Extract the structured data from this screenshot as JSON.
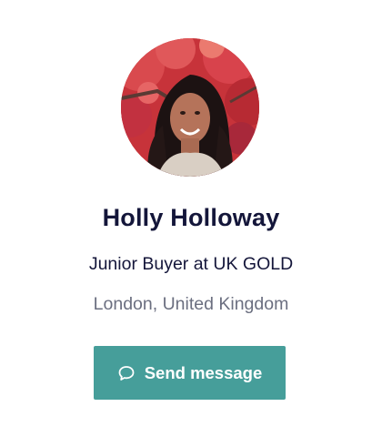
{
  "profile": {
    "name": "Holly Holloway",
    "role": "Junior Buyer at UK GOLD",
    "location": "London, United Kingdom",
    "avatar_icon": "profile-photo"
  },
  "actions": {
    "send_message_label": "Send message",
    "send_message_icon": "chat-bubble-icon"
  },
  "colors": {
    "name_text": "#14163a",
    "location_text": "#6b6f80",
    "button_bg": "#469e9a",
    "button_text": "#ffffff"
  }
}
